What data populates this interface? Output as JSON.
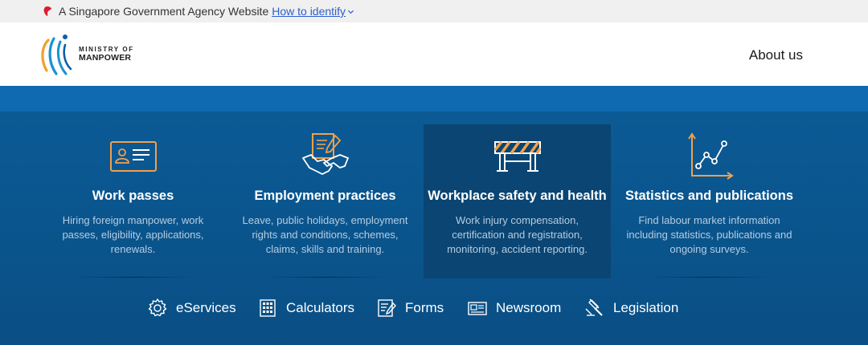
{
  "masthead": {
    "text": "A Singapore Government Agency Website",
    "link": "How to identify",
    "lion_icon": "singapore-lion-icon"
  },
  "header": {
    "logo_line1": "MINISTRY OF",
    "logo_line2": "MANPOWER",
    "nav_about": "About us"
  },
  "colors": {
    "stripe": "#0f6ab1",
    "main_bg": "#0a5188",
    "active_card": "#0a4573",
    "accent": "#f2a04b"
  },
  "cards": [
    {
      "title": "Work passes",
      "desc": [
        "Hiring foreign manpower, work",
        "passes, eligibility, applications,",
        "renewals."
      ],
      "icon": "id-card-icon"
    },
    {
      "title": "Employment practices",
      "desc": [
        "Leave, public holidays, employment",
        "rights and conditions, schemes,",
        "claims, skills and training."
      ],
      "icon": "handshake-document-icon"
    },
    {
      "title": "Workplace safety and health",
      "desc": [
        "Work injury compensation,",
        "certification and registration,",
        "monitoring, accident reporting."
      ],
      "icon": "road-barrier-icon"
    },
    {
      "title": "Statistics and publications",
      "desc": [
        "Find labour market information",
        "including statistics, publications and",
        "ongoing surveys."
      ],
      "icon": "line-chart-icon"
    }
  ],
  "quick_links": [
    {
      "label": "eServices",
      "icon": "gear-icon"
    },
    {
      "label": "Calculators",
      "icon": "calculator-icon"
    },
    {
      "label": "Forms",
      "icon": "form-edit-icon"
    },
    {
      "label": "Newsroom",
      "icon": "newspaper-icon"
    },
    {
      "label": "Legislation",
      "icon": "gavel-icon"
    }
  ]
}
